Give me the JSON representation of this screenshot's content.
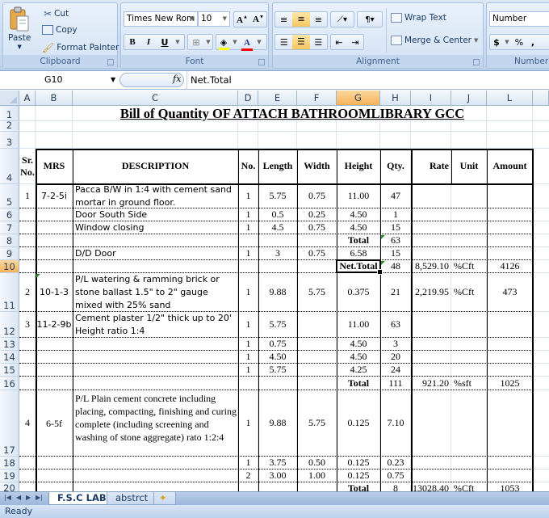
{
  "ribbon": {
    "clipboard": {
      "paste_label": "Paste",
      "cut_label": "Cut",
      "copy_label": "Copy",
      "format_painter_label": "Format Painter",
      "group_label": "Clipboard"
    },
    "font": {
      "font_name": "Times New Rom",
      "font_size": "10",
      "grow_label": "A",
      "shrink_label": "A",
      "bold_label": "B",
      "italic_label": "I",
      "underline_label": "U",
      "font_color_label": "A",
      "fill_color": "#ffff00",
      "font_color": "#ff0000",
      "group_label": "Font"
    },
    "alignment": {
      "wrap_text_label": "Wrap Text",
      "merge_center_label": "Merge & Center",
      "group_label": "Alignment"
    },
    "number": {
      "format": "Number",
      "currency_label": "$",
      "percent_label": "%",
      "comma_label": ",",
      "group_label": "Number"
    }
  },
  "formula_bar": {
    "name_box": "G10",
    "fx_label": "fx",
    "value": "Net.Total"
  },
  "columns": [
    "A",
    "B",
    "C",
    "D",
    "E",
    "F",
    "G",
    "H",
    "I",
    "J",
    "L"
  ],
  "selected_column": "G",
  "rows": [
    "1",
    "2",
    "3",
    "4",
    "5",
    "6",
    "7",
    "8",
    "9",
    "10",
    "11",
    "12",
    "13",
    "14",
    "15",
    "16",
    "17",
    "18",
    "19",
    "20"
  ],
  "selected_row": "10",
  "sheet": {
    "title": "Bill of Quantity OF ATTACH BATHROOMLIBRARY GCC",
    "headers": {
      "sr": "Sr. No.",
      "mrs": "MRS",
      "description": "DESCRIPTION",
      "no": "No.",
      "length": "Length",
      "width": "Width",
      "height": "Height",
      "qty": "Qty.",
      "rate": "Rate",
      "unit": "Unit",
      "amount": "Amount"
    },
    "rows": [
      {
        "row": "5",
        "sr": "1",
        "mrs": "7-2-5i",
        "description": "Pacca B/W in 1:4 with cement sand mortar in ground floor.",
        "no": "1",
        "length": "5.75",
        "width": "0.75",
        "height": "11.00",
        "qty": "47",
        "rate": "",
        "unit": "",
        "amount": ""
      },
      {
        "row": "6",
        "sr": "",
        "mrs": "",
        "description": "Door  South Side",
        "no": "1",
        "length": "0.5",
        "width": "0.25",
        "height": "4.50",
        "qty": "1",
        "rate": "",
        "unit": "",
        "amount": ""
      },
      {
        "row": "7",
        "sr": "",
        "mrs": "",
        "description": "Window closing",
        "no": "1",
        "length": "4.5",
        "width": "0.75",
        "height": "4.50",
        "qty": "15",
        "rate": "",
        "unit": "",
        "amount": ""
      },
      {
        "row": "8",
        "sr": "",
        "mrs": "",
        "description": "",
        "no": "",
        "length": "",
        "width": "",
        "height": "Total",
        "qty": "63",
        "rate": "",
        "unit": "",
        "amount": ""
      },
      {
        "row": "9",
        "sr": "",
        "mrs": "",
        "description": "D/D Door",
        "no": "1",
        "length": "3",
        "width": "0.75",
        "height": "6.58",
        "qty": "15",
        "rate": "",
        "unit": "",
        "amount": ""
      },
      {
        "row": "10",
        "sr": "",
        "mrs": "",
        "description": "",
        "no": "",
        "length": "",
        "width": "",
        "height": "Net.Total",
        "qty": "48",
        "rate": "8,529.10",
        "unit": "%Cft",
        "amount": "4126"
      },
      {
        "row": "11",
        "sr": "2",
        "mrs": "10-1-3",
        "description": "P/L watering & ramming brick or stone ballast 1.5\" to 2\" gauge mixed with 25% sand",
        "no": "1",
        "length": "9.88",
        "width": "5.75",
        "height": "0.375",
        "qty": "21",
        "rate": "2,219.95",
        "unit": "%Cft",
        "amount": "473"
      },
      {
        "row": "12",
        "sr": "3",
        "mrs": "11-2-9b",
        "description": "Cement plaster 1/2\" thick up to 20' Height   ratio 1:4",
        "no": "1",
        "length": "5.75",
        "width": "",
        "height": "11.00",
        "qty": "63",
        "rate": "",
        "unit": "",
        "amount": ""
      },
      {
        "row": "13",
        "sr": "",
        "mrs": "",
        "description": "",
        "no": "1",
        "length": "0.75",
        "width": "",
        "height": "4.50",
        "qty": "3",
        "rate": "",
        "unit": "",
        "amount": ""
      },
      {
        "row": "14",
        "sr": "",
        "mrs": "",
        "description": "",
        "no": "1",
        "length": "4.50",
        "width": "",
        "height": "4.50",
        "qty": "20",
        "rate": "",
        "unit": "",
        "amount": ""
      },
      {
        "row": "15",
        "sr": "",
        "mrs": "",
        "description": "",
        "no": "1",
        "length": "5.75",
        "width": "",
        "height": "4.25",
        "qty": "24",
        "rate": "",
        "unit": "",
        "amount": ""
      },
      {
        "row": "16",
        "sr": "",
        "mrs": "",
        "description": "",
        "no": "",
        "length": "",
        "width": "",
        "height": "Total",
        "qty": "111",
        "rate": "921.20",
        "unit": "%sft",
        "amount": "1025"
      },
      {
        "row": "17",
        "sr": "4",
        "mrs": "6-5f",
        "description": "P/L Plain cement concrete including placing, compacting, finishing and curing complete (including screening and washing of stone aggregate) rato 1:2:4",
        "no": "1",
        "length": "9.88",
        "width": "5.75",
        "height": "0.125",
        "qty": "7.10",
        "rate": "",
        "unit": "",
        "amount": ""
      },
      {
        "row": "18",
        "sr": "",
        "mrs": "",
        "description": "",
        "no": "1",
        "length": "3.75",
        "width": "0.50",
        "height": "0.125",
        "qty": "0.23",
        "rate": "",
        "unit": "",
        "amount": ""
      },
      {
        "row": "19",
        "sr": "",
        "mrs": "",
        "description": "",
        "no": "2",
        "length": "3.00",
        "width": "1.00",
        "height": "0.125",
        "qty": "0.75",
        "rate": "",
        "unit": "",
        "amount": ""
      },
      {
        "row": "20",
        "sr": "",
        "mrs": "",
        "description": "",
        "no": "",
        "length": "",
        "width": "",
        "height": "Total",
        "qty": "8",
        "rate": "13028.40",
        "unit": "%Cft",
        "amount": "1053"
      }
    ]
  },
  "sheet_tabs": [
    {
      "label": "F.S.C LAB",
      "active": true
    },
    {
      "label": "abstrct",
      "active": false
    }
  ],
  "status_bar": {
    "text": "Ready"
  }
}
